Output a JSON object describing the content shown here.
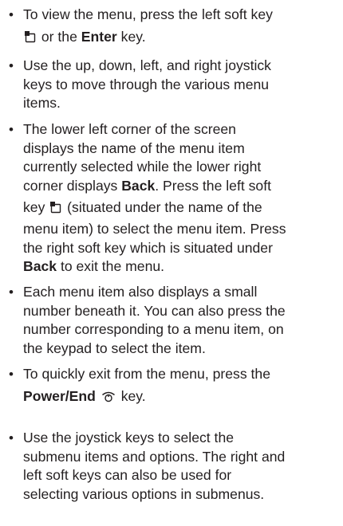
{
  "bullets": [
    {
      "l1": "To view the menu, press the left soft key",
      "l2_post": "or the",
      "l2_bold": "Enter",
      "l2_end": "key."
    },
    {
      "l1": "Use the up, down, left, and right joystick",
      "l2": "keys to move through the various menu",
      "l3": "items."
    },
    {
      "l1": "The lower left corner of the screen",
      "l2": "displays the name of the menu item",
      "l3": "currently selected while the lower right",
      "l4_pre": "corner displays",
      "l4_bold": "Back",
      "l4_post": ". Press the left soft",
      "l5_pre": "key",
      "l5_post": "(situated under the name of the",
      "l6": "menu item) to select the menu item. Press",
      "l7": "the right soft key which is situated under",
      "l8_bold": "Back",
      "l8_post": "to exit the menu."
    },
    {
      "l1": "Each menu item also displays a small",
      "l2": "number beneath it. You can also press the",
      "l3": "number corresponding to a menu item, on",
      "l4": "the keypad to select the item."
    },
    {
      "l1": "To quickly exit from the menu, press the",
      "l2_bold": "Power/End",
      "l2_post": "key."
    },
    {
      "l1": "Use the joystick keys to select the",
      "l2": "submenu items and options. The right and",
      "l3": "left soft keys can also be used for",
      "l4": "selecting various options in submenus."
    }
  ],
  "bullet_char": "•",
  "icons": [
    "left-soft-key-icon",
    "power-end-key-icon"
  ]
}
